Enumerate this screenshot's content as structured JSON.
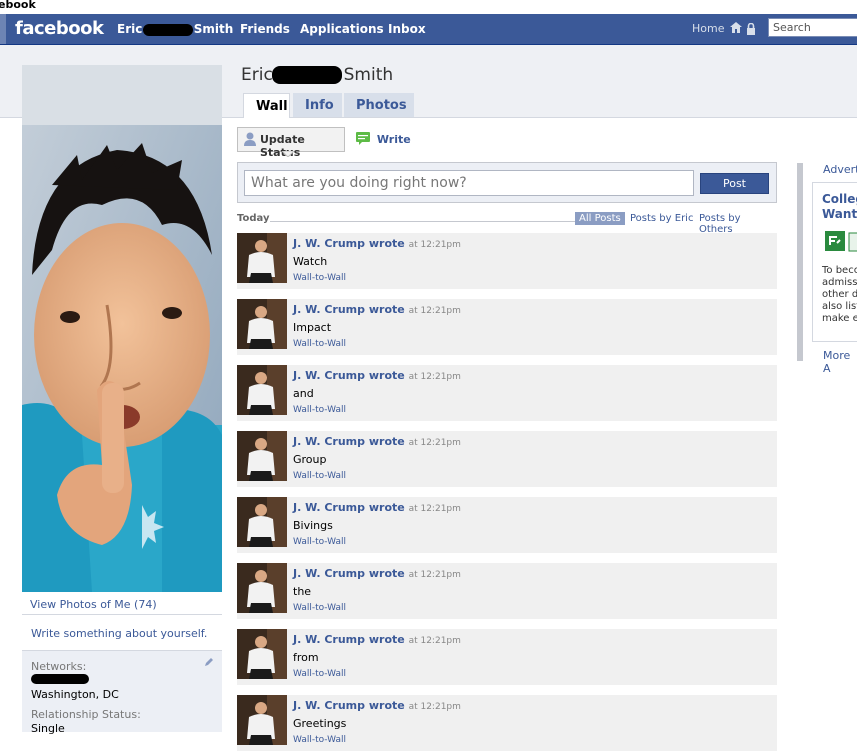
{
  "window": {
    "title_fragment": "ebook"
  },
  "topbar": {
    "logo": "facebook",
    "profile_link_first": "Eric",
    "profile_link_last": "Smith",
    "friends": "Friends",
    "applications": "Applications",
    "inbox": "Inbox",
    "home": "Home",
    "search_placeholder": "Search"
  },
  "profile": {
    "first_name": "Eric",
    "last_name": "Smith",
    "view_photos": "View Photos of Me (74)",
    "write_about": "Write something about yourself.",
    "networks_label": "Networks:",
    "network_location": "Washington, DC",
    "relationship_label": "Relationship Status:",
    "relationship_value": "Single"
  },
  "tabs": [
    {
      "label": "Wall",
      "active": true
    },
    {
      "label": "Info",
      "active": false
    },
    {
      "label": "Photos",
      "active": false
    }
  ],
  "publisher": {
    "update_status": "Update Status",
    "write": "Write",
    "input_placeholder": "What are you doing right now?",
    "post_button": "Post"
  },
  "filter": {
    "today": "Today",
    "all_posts": "All Posts",
    "posts_by_eric": "Posts by Eric",
    "posts_by_others": "Posts by Others"
  },
  "stories": [
    {
      "author": "J. W. Crump",
      "verb": "wrote",
      "time": "at 12:21pm",
      "message": "Watch",
      "link": "Wall-to-Wall"
    },
    {
      "author": "J. W. Crump",
      "verb": "wrote",
      "time": "at 12:21pm",
      "message": "Impact",
      "link": "Wall-to-Wall"
    },
    {
      "author": "J. W. Crump",
      "verb": "wrote",
      "time": "at 12:21pm",
      "message": "and",
      "link": "Wall-to-Wall"
    },
    {
      "author": "J. W. Crump",
      "verb": "wrote",
      "time": "at 12:21pm",
      "message": "Group",
      "link": "Wall-to-Wall"
    },
    {
      "author": "J. W. Crump",
      "verb": "wrote",
      "time": "at 12:21pm",
      "message": "Bivings",
      "link": "Wall-to-Wall"
    },
    {
      "author": "J. W. Crump",
      "verb": "wrote",
      "time": "at 12:21pm",
      "message": "the",
      "link": "Wall-to-Wall"
    },
    {
      "author": "J. W. Crump",
      "verb": "wrote",
      "time": "at 12:21pm",
      "message": "from",
      "link": "Wall-to-Wall"
    },
    {
      "author": "J. W. Crump",
      "verb": "wrote",
      "time": "at 12:21pm",
      "message": "Greetings",
      "link": "Wall-to-Wall"
    }
  ],
  "ads": {
    "title": "Advert",
    "headline": "Colleg Wante",
    "body": "To becc admissi other d also list make e",
    "more": "More A"
  },
  "colors": {
    "brand": "#3b5998",
    "bar": "#3b5998",
    "story_bg": "#f0f0f0"
  }
}
